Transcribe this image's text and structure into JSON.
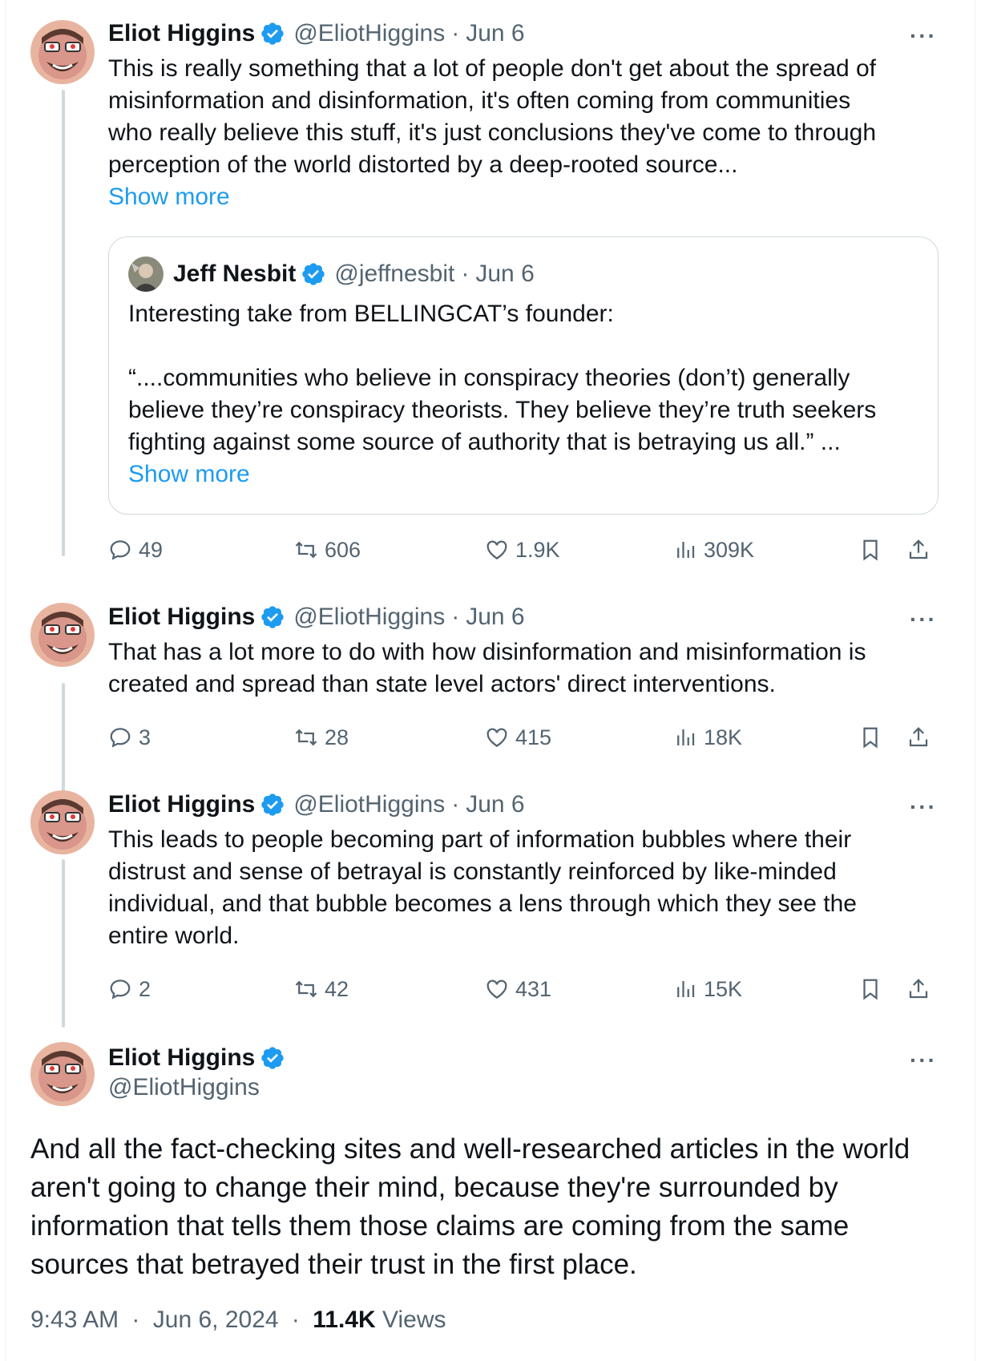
{
  "colors": {
    "accent": "#1d9bf0",
    "text_primary": "#0f1419",
    "text_secondary": "#536471",
    "thread_line": "#cfd9de"
  },
  "tweets": [
    {
      "author": "Eliot Higgins",
      "handle": "@EliotHiggins",
      "separator": "·",
      "date": "Jun 6",
      "more_label": "···",
      "lines": [
        "This is really something that a lot of people don't get about the spread of",
        "misinformation and disinformation, it's often coming from communities",
        "who really believe this stuff, it's just conclusions they've come to through",
        "perception of the world distorted by a deep-rooted source..."
      ],
      "show_more": "Show more",
      "quote": {
        "author": "Jeff Nesbit",
        "handle": "@jeffnesbit",
        "separator": "·",
        "date": "Jun 6",
        "intro": "Interesting take from BELLINGCAT’s founder:",
        "lines": [
          "“....communities who believe in conspiracy theories (don’t) generally",
          "believe they’re conspiracy theorists. They believe they’re truth seekers",
          "fighting against some source of authority that is betraying us all.” ..."
        ],
        "show_more": "Show more"
      },
      "stats": {
        "replies": "49",
        "reposts": "606",
        "likes": "1.9K",
        "views": "309K"
      }
    },
    {
      "author": "Eliot Higgins",
      "handle": "@EliotHiggins",
      "separator": "·",
      "date": "Jun 6",
      "more_label": "···",
      "lines": [
        "That has a lot more to do with how disinformation and misinformation is",
        "created and spread than state level actors' direct interventions."
      ],
      "stats": {
        "replies": "3",
        "reposts": "28",
        "likes": "415",
        "views": "18K"
      }
    },
    {
      "author": "Eliot Higgins",
      "handle": "@EliotHiggins",
      "separator": "·",
      "date": "Jun 6",
      "more_label": "···",
      "lines": [
        "This leads to people becoming part of information bubbles where their",
        "distrust and sense of betrayal is constantly reinforced by like-minded",
        "individual, and that bubble becomes a lens through which they see the",
        "entire world."
      ],
      "stats": {
        "replies": "2",
        "reposts": "42",
        "likes": "431",
        "views": "15K"
      }
    }
  ],
  "main_tweet": {
    "author": "Eliot Higgins",
    "handle": "@EliotHiggins",
    "more_label": "···",
    "lines": [
      "And all the fact-checking sites and well-researched articles in the world",
      "aren't going to change their mind, because they're surrounded by",
      "information that tells them those claims are coming from the same",
      "sources that betrayed their trust in the first place."
    ],
    "time": "9:43 AM",
    "separator": "·",
    "date": "Jun 6, 2024",
    "views_count": "11.4K",
    "views_label": "Views"
  }
}
